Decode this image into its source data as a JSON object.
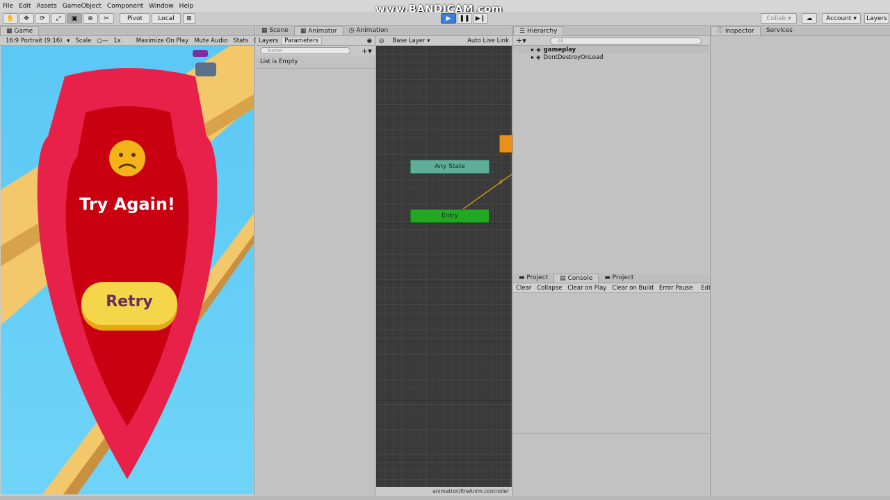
{
  "menu": [
    "File",
    "Edit",
    "Assets",
    "GameObject",
    "Component",
    "Window",
    "Help"
  ],
  "toolbar": {
    "pivot": "Pivot",
    "local": "Local",
    "collab": "Collab",
    "account": "Account",
    "layers": "Layers"
  },
  "watermark": "www.BANDICAM.com",
  "game": {
    "tab": "Game",
    "resolution": "16:9 Portrait (9:16)",
    "scale_label": "Scale",
    "scale_value": "1x",
    "maximize": "Maximize On Play",
    "mute": "Mute Audio",
    "stats": "Stats",
    "gizmos": "G",
    "message": "Try Again!",
    "retry": "Retry"
  },
  "animator": {
    "tabs": [
      "Scene",
      "Animator",
      "Animation"
    ],
    "layers_tab": "Layers",
    "parameters_tab": "Parameters",
    "search_placeholder": "Name",
    "list_empty": "List is Empty",
    "base_layer": "Base Layer",
    "auto_live_link": "Auto Live Link",
    "any_state": "Any State",
    "entry": "Entry",
    "footer": "animation/fireAnim.controller"
  },
  "hierarchy": {
    "tab": "Hierarchy",
    "search_placeholder": "All",
    "items": [
      "gameplay",
      "DontDestroyOnLoad"
    ]
  },
  "inspector": {
    "tabs": [
      "Inspector",
      "Services"
    ]
  },
  "console": {
    "tabs": [
      "Project",
      "Console",
      "Project"
    ],
    "buttons": [
      "Clear",
      "Collapse",
      "Clear on Play",
      "Clear on Build",
      "Error Pause",
      "Editor"
    ]
  },
  "colors": {
    "accent": "#3b7dd8",
    "entry": "#22a822",
    "any_state": "#5fae99",
    "orange_state": "#e8901a",
    "shield": "#e8214a",
    "shield_inner": "#c8000f",
    "retry": "#f5c53b"
  }
}
